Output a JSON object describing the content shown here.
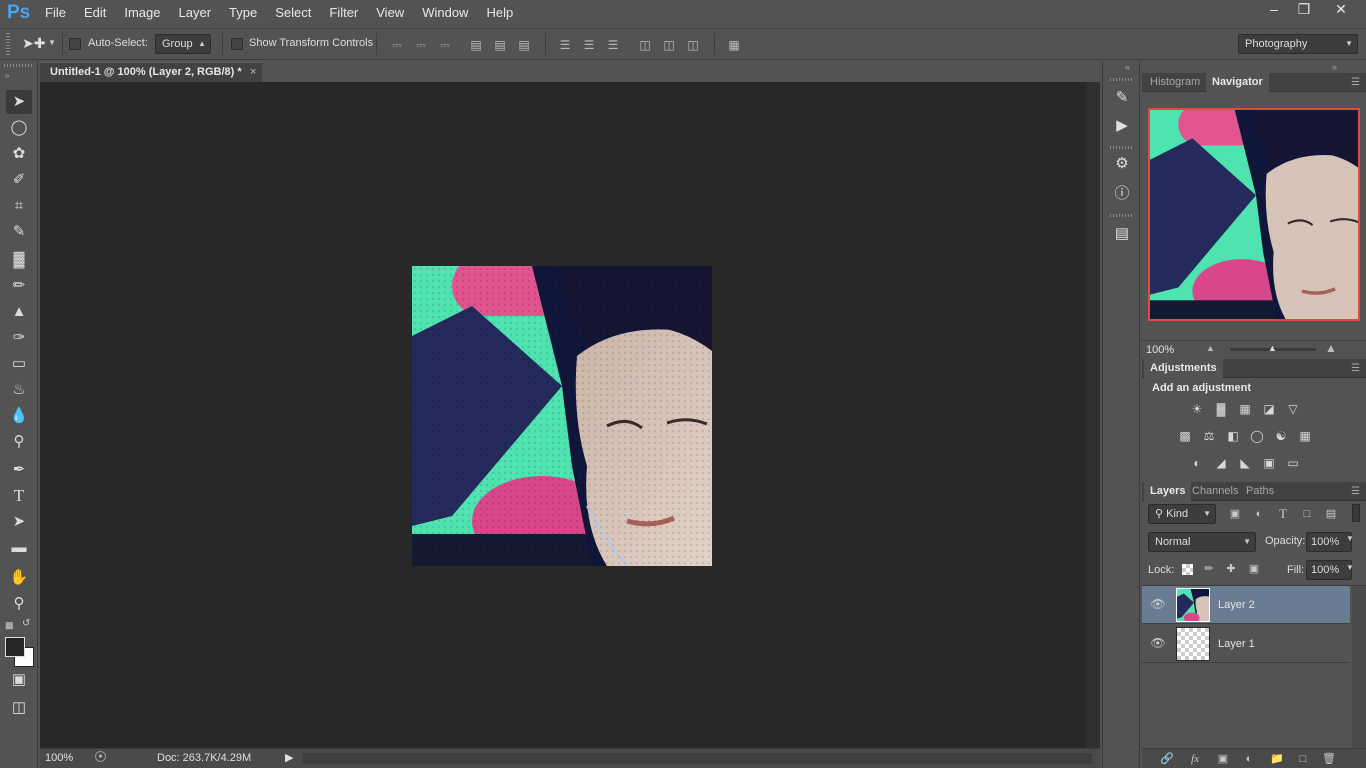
{
  "app": {
    "logo": "Ps"
  },
  "menu": [
    "File",
    "Edit",
    "Image",
    "Layer",
    "Type",
    "Select",
    "Filter",
    "View",
    "Window",
    "Help"
  ],
  "window_controls": {
    "minimize": "–",
    "restore": "❐",
    "close": "✕"
  },
  "options": {
    "auto_select_label": "Auto-Select:",
    "auto_select_value": "Group",
    "transform_label": "Show Transform Controls",
    "workspace": "Photography"
  },
  "document": {
    "tab_title": "Untitled-1 @ 100% (Layer 2, RGB/8) *",
    "close": "×",
    "zoom": "100%",
    "doc_info": "Doc: 263.7K/4.29M"
  },
  "navigator": {
    "tabs": [
      "Histogram",
      "Navigator"
    ],
    "active_tab": "Navigator",
    "zoom": "100%"
  },
  "adjustments": {
    "title": "Adjustments",
    "prompt": "Add an adjustment"
  },
  "layers_panel": {
    "tabs": [
      "Layers",
      "Channels",
      "Paths"
    ],
    "filter_kind": "Kind",
    "blend_mode": "Normal",
    "opacity_label": "Opacity:",
    "opacity": "100%",
    "lock_label": "Lock:",
    "fill_label": "Fill:",
    "fill": "100%",
    "layers": [
      {
        "name": "Layer 2",
        "selected": true
      },
      {
        "name": "Layer 1",
        "selected": false
      }
    ]
  },
  "footer_icons": [
    "link-icon",
    "fx-icon",
    "mask-icon",
    "adjustment-layer-icon",
    "group-folder-icon",
    "new-layer-icon",
    "trash-icon"
  ],
  "colors": {
    "accent": "#4ea3e8",
    "selected_layer": "#6a7b94",
    "canvas": "#282828"
  }
}
